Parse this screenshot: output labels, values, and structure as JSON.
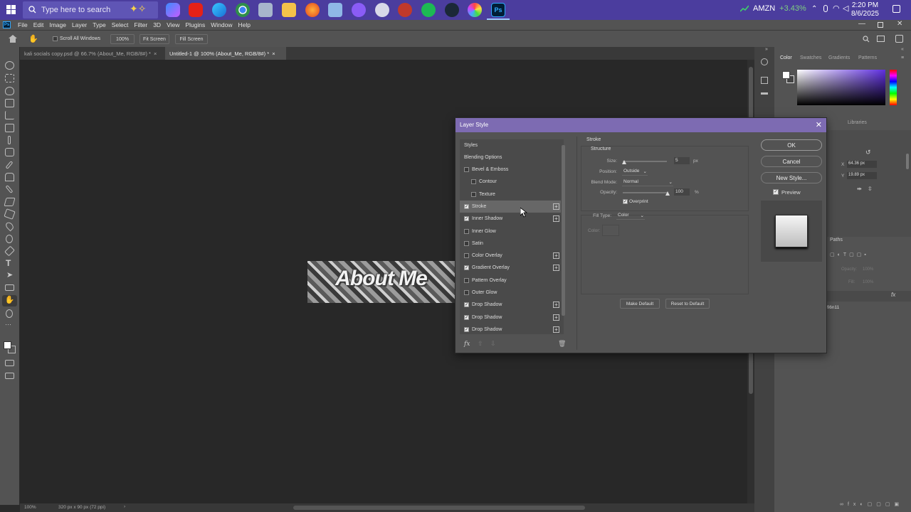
{
  "taskbar": {
    "search_placeholder": "Type here to search",
    "stock_symbol": "AMZN",
    "stock_change": "+3.43%",
    "time": "2:20 PM",
    "date": "8/6/2025"
  },
  "menubar": {
    "items": [
      "File",
      "Edit",
      "Image",
      "Layer",
      "Type",
      "Select",
      "Filter",
      "3D",
      "View",
      "Plugins",
      "Window",
      "Help"
    ]
  },
  "options_bar": {
    "scroll_all_windows": "Scroll All Windows",
    "zoom_value": "100%",
    "fit_screen": "Fit Screen",
    "fill_screen": "Fill Screen"
  },
  "tabs": [
    {
      "label": "kali socials copy.psd @ 66.7% (About_Me, RGB/8#) *"
    },
    {
      "label": "Untitled-1 @ 100% (About_Me, RGB/8#) *"
    }
  ],
  "canvas": {
    "banner_text": "About Me"
  },
  "statusbar": {
    "zoom": "100%",
    "doc_info": "320 px x 90 px (72 ppi)"
  },
  "right_panel": {
    "tabs": [
      "Color",
      "Swatches",
      "Gradients",
      "Patterns"
    ],
    "libraries": "Libraries",
    "x_value": "64.36 px",
    "y_value": "19.89 px",
    "paths_tab": "Paths",
    "opacity_label": "Opacity:",
    "opacity_value": "100%",
    "fill_label": "Fill:",
    "fill_value": "100%",
    "layer_name": "fi6n11"
  },
  "dialog": {
    "title": "Layer Style",
    "styles_header": "Styles",
    "blending_options": "Blending Options",
    "style_items": [
      {
        "label": "Bevel & Emboss",
        "checked": false,
        "plus": false,
        "indent": false
      },
      {
        "label": "Contour",
        "checked": false,
        "plus": false,
        "indent": true
      },
      {
        "label": "Texture",
        "checked": false,
        "plus": false,
        "indent": true
      },
      {
        "label": "Stroke",
        "checked": true,
        "plus": true,
        "indent": false,
        "selected": true
      },
      {
        "label": "Inner Shadow",
        "checked": true,
        "plus": true,
        "indent": false
      },
      {
        "label": "Inner Glow",
        "checked": false,
        "plus": false,
        "indent": false
      },
      {
        "label": "Satin",
        "checked": false,
        "plus": false,
        "indent": false
      },
      {
        "label": "Color Overlay",
        "checked": false,
        "plus": true,
        "indent": false
      },
      {
        "label": "Gradient Overlay",
        "checked": true,
        "plus": true,
        "indent": false
      },
      {
        "label": "Pattern Overlay",
        "checked": false,
        "plus": false,
        "indent": false
      },
      {
        "label": "Outer Glow",
        "checked": false,
        "plus": false,
        "indent": false
      },
      {
        "label": "Drop Shadow",
        "checked": true,
        "plus": true,
        "indent": false
      },
      {
        "label": "Drop Shadow",
        "checked": true,
        "plus": true,
        "indent": false
      },
      {
        "label": "Drop Shadow",
        "checked": true,
        "plus": true,
        "indent": false
      }
    ],
    "fx_label": "fx",
    "section_title": "Stroke",
    "structure_label": "Structure",
    "size_label": "Size:",
    "size_value": "5",
    "size_unit": "px",
    "position_label": "Position:",
    "position_value": "Outside",
    "blend_mode_label": "Blend Mode:",
    "blend_mode_value": "Normal",
    "opacity_label": "Opacity:",
    "opacity_value": "100",
    "opacity_unit": "%",
    "overprint_label": "Overprint",
    "overprint_checked": true,
    "fill_type_label": "Fill Type:",
    "fill_type_value": "Color",
    "color_label": "Color:",
    "make_default": "Make Default",
    "reset_to_default": "Reset to Default",
    "ok": "OK",
    "cancel": "Cancel",
    "new_style": "New Style...",
    "preview_label": "Preview",
    "preview_checked": true
  }
}
